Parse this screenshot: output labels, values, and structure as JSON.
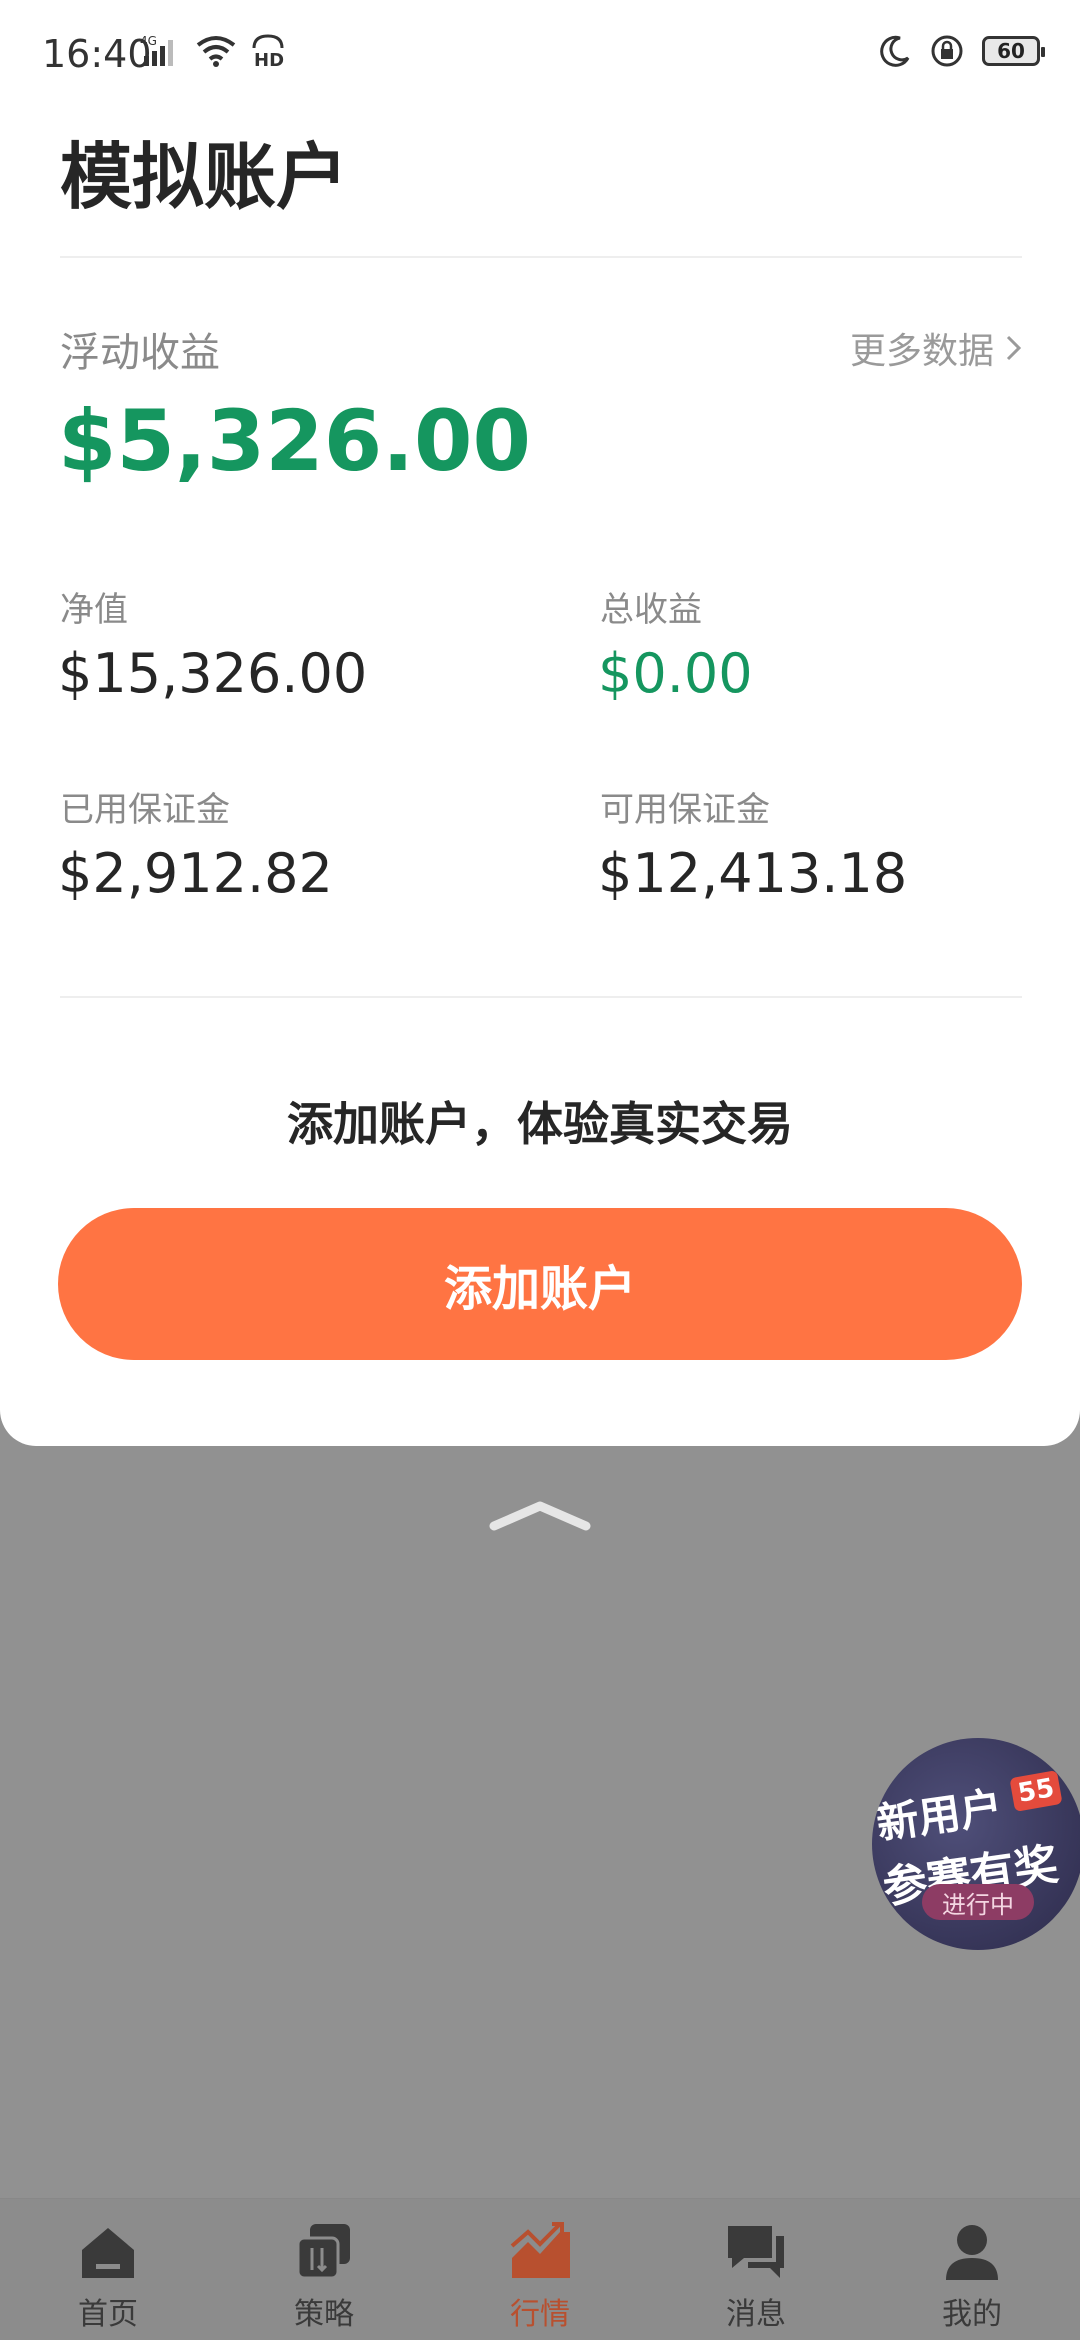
{
  "status_bar": {
    "time": "16:40",
    "network": "4G",
    "hd_label": "HD",
    "battery": "60"
  },
  "page": {
    "title": "模拟账户"
  },
  "summary": {
    "floating_pnl_label": "浮动收益",
    "floating_pnl_value": "$5,326.00",
    "more_data_label": "更多数据"
  },
  "stats": {
    "net_value_label": "净值",
    "net_value": "$15,326.00",
    "total_pnl_label": "总收益",
    "total_pnl": "$0.00",
    "used_margin_label": "已用保证金",
    "used_margin": "$2,912.82",
    "available_margin_label": "可用保证金",
    "available_margin": "$12,413.18"
  },
  "promo": {
    "text": "添加账户，体验真实交易",
    "button_label": "添加账户"
  },
  "badge": {
    "line1": "新用户",
    "line2": "参赛有奖",
    "tag": "55",
    "status": "进行中"
  },
  "tabs": [
    {
      "label": "首页",
      "icon": "home-icon"
    },
    {
      "label": "策略",
      "icon": "strategy-icon"
    },
    {
      "label": "行情",
      "icon": "market-chart-icon",
      "active": true
    },
    {
      "label": "消息",
      "icon": "message-icon"
    },
    {
      "label": "我的",
      "icon": "profile-icon"
    }
  ],
  "colors": {
    "positive": "#15965f",
    "accent": "#ff7443",
    "overlay": "#919191"
  }
}
